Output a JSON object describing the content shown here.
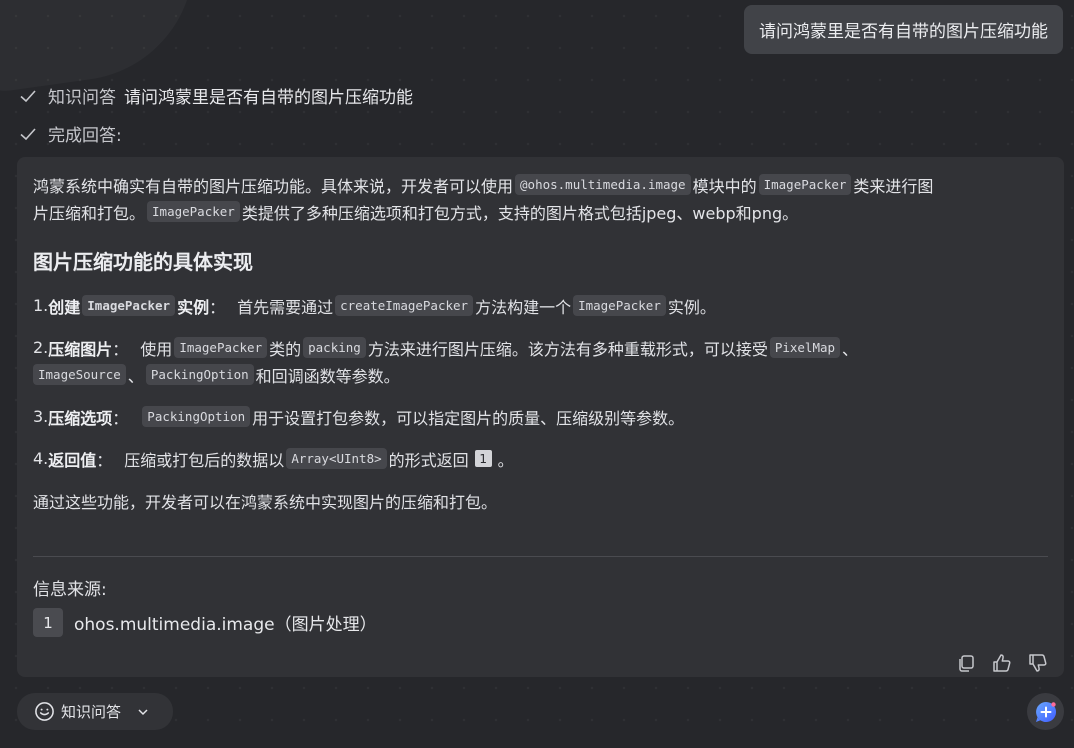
{
  "user_message": "请问鸿蒙里是否有自带的图片压缩功能",
  "steps": [
    {
      "label": "知识问答",
      "query": "请问鸿蒙里是否有自带的图片压缩功能"
    },
    {
      "label": "完成回答:",
      "query": ""
    }
  ],
  "answer": {
    "intro": {
      "t1": "鸿蒙系统中确实有自带的图片压缩功能。具体来说，开发者可以使用",
      "c1": "@ohos.multimedia.image",
      "t2": "模块中的",
      "c2": "ImagePacker",
      "t3": "类来进行图",
      "t4": "片压缩和打包。",
      "c3": "ImagePacker",
      "t5": "类提供了多种压缩选项和打包方式，支持的图片格式包括jpeg、webp和png。"
    },
    "heading": "图片压缩功能的具体实现",
    "items": [
      {
        "num": "1.",
        "bold_a": "创建",
        "code_b": "ImagePacker",
        "bold_c": "实例",
        "sep": "：",
        "t1": "首先需要通过",
        "c1": "createImagePacker",
        "t2": "方法构建一个",
        "c2": "ImagePacker",
        "t3": "实例。"
      },
      {
        "num": "2.",
        "bold": "压缩图片",
        "sep": "：",
        "t1": "使用",
        "c1": "ImagePacker",
        "t2": "类的",
        "c2": "packing",
        "t3": "方法来进行图片压缩。该方法有多种重载形式，可以接受",
        "c3": "PixelMap",
        "t4": "、",
        "c4": "ImageSource",
        "t5": "、",
        "c5": "PackingOption",
        "t6": "和回调函数等参数。"
      },
      {
        "num": "3.",
        "bold": "压缩选项",
        "sep": "：",
        "c1": "PackingOption",
        "t1": "用于设置打包参数，可以指定图片的质量、压缩级别等参数。"
      },
      {
        "num": "4.",
        "bold": "返回值",
        "sep": "：",
        "t1": "压缩或打包后的数据以",
        "c1": "Array<UInt8>",
        "t2": "的形式返回",
        "ref": "1",
        "t3": "。"
      }
    ],
    "conclusion": "通过这些功能，开发者可以在鸿蒙系统中实现图片的压缩和打包。",
    "sources_title": "信息来源:",
    "sources": [
      {
        "num": "1",
        "text": "ohos.multimedia.image（图片处理）"
      }
    ]
  },
  "action_icons": [
    "copy-icon",
    "thumbs-up-icon",
    "thumbs-down-icon"
  ],
  "mode_selector": {
    "label": "知识问答",
    "icon": "chat-bubble-icon"
  },
  "new_chat_icon": "new-chat-icon",
  "colors": {
    "background": "#26272b",
    "card": "#313236",
    "bubble": "#414348",
    "accent": "#4f7dff"
  }
}
